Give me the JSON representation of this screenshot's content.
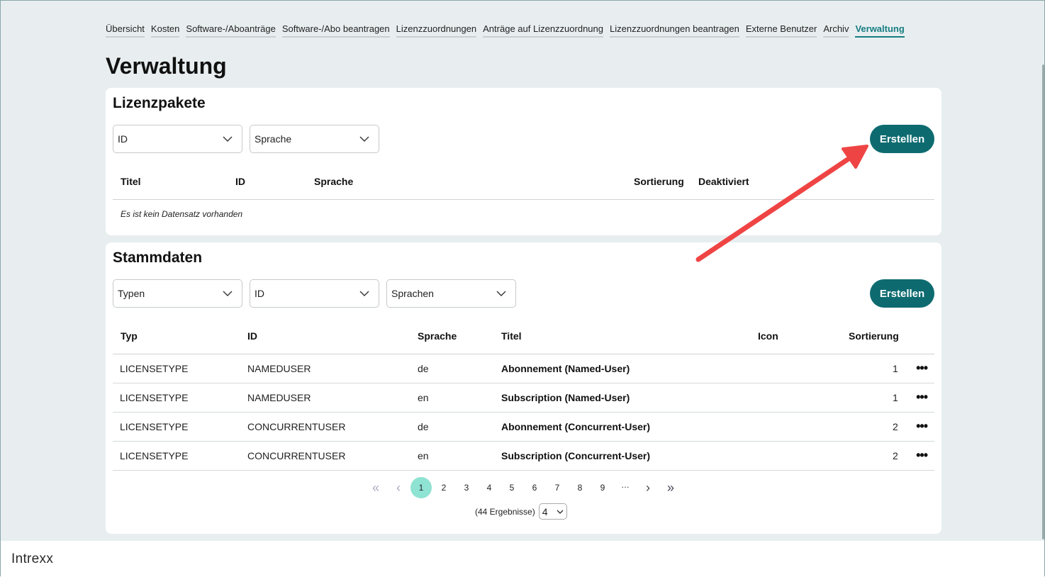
{
  "nav": {
    "items": [
      "Übersicht",
      "Kosten",
      "Software-/Aboanträge",
      "Software-/Abo beantragen",
      "Lizenzzuordnungen",
      "Anträge auf Lizenzzuordnung",
      "Lizenzzuordnungen beantragen",
      "Externe Benutzer",
      "Archiv",
      "Verwaltung"
    ],
    "active": "Verwaltung"
  },
  "page_title": "Verwaltung",
  "lizenzpakete": {
    "title": "Lizenzpakete",
    "filters": [
      "ID",
      "Sprache"
    ],
    "create_label": "Erstellen",
    "columns": [
      "Titel",
      "ID",
      "Sprache",
      "Sortierung",
      "Deaktiviert"
    ],
    "empty_text": "Es ist kein Datensatz vorhanden"
  },
  "stammdaten": {
    "title": "Stammdaten",
    "filters": [
      "Typen",
      "ID",
      "Sprachen"
    ],
    "create_label": "Erstellen",
    "columns": [
      "Typ",
      "ID",
      "Sprache",
      "Titel",
      "Icon",
      "Sortierung"
    ],
    "rows": [
      {
        "typ": "LICENSETYPE",
        "id": "NAMEDUSER",
        "sprache": "de",
        "titel": "Abonnement (Named-User)",
        "sortierung": "1"
      },
      {
        "typ": "LICENSETYPE",
        "id": "NAMEDUSER",
        "sprache": "en",
        "titel": "Subscription (Named-User)",
        "sortierung": "1"
      },
      {
        "typ": "LICENSETYPE",
        "id": "CONCURRENTUSER",
        "sprache": "de",
        "titel": "Abonnement (Concurrent-User)",
        "sortierung": "2"
      },
      {
        "typ": "LICENSETYPE",
        "id": "CONCURRENTUSER",
        "sprache": "en",
        "titel": "Subscription (Concurrent-User)",
        "sortierung": "2"
      }
    ],
    "row_menu_icon": "more-dots-icon",
    "pagination": {
      "pages": [
        "1",
        "2",
        "3",
        "4",
        "5",
        "6",
        "7",
        "8",
        "9",
        "…"
      ],
      "current": "1",
      "result_text": "(44 Ergebnisse)",
      "page_size": "4"
    }
  },
  "footer": {
    "logo": "Intrexx"
  },
  "annotation": {
    "color": "#ef4444"
  }
}
